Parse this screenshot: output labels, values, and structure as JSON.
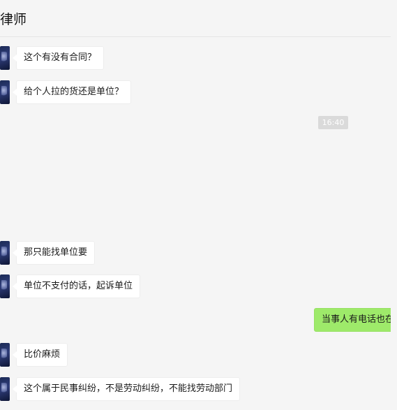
{
  "header": {
    "title": "律师"
  },
  "chat": {
    "messages": [
      {
        "side": "left",
        "text": "这个有没有合同？"
      },
      {
        "side": "left",
        "text": "给个人拉的货还是单位？"
      },
      {
        "type": "time",
        "text": "16:40"
      },
      {
        "side": "left",
        "text": "那只能找单位要"
      },
      {
        "side": "left",
        "text": "单位不支付的话，起诉单位"
      },
      {
        "side": "right",
        "text": "当事人有电话也在"
      },
      {
        "side": "left",
        "text": "比价麻烦"
      },
      {
        "side": "left",
        "text": "这个属于民事纠纷，不是劳动纠纷，不能找劳动部门"
      }
    ]
  }
}
